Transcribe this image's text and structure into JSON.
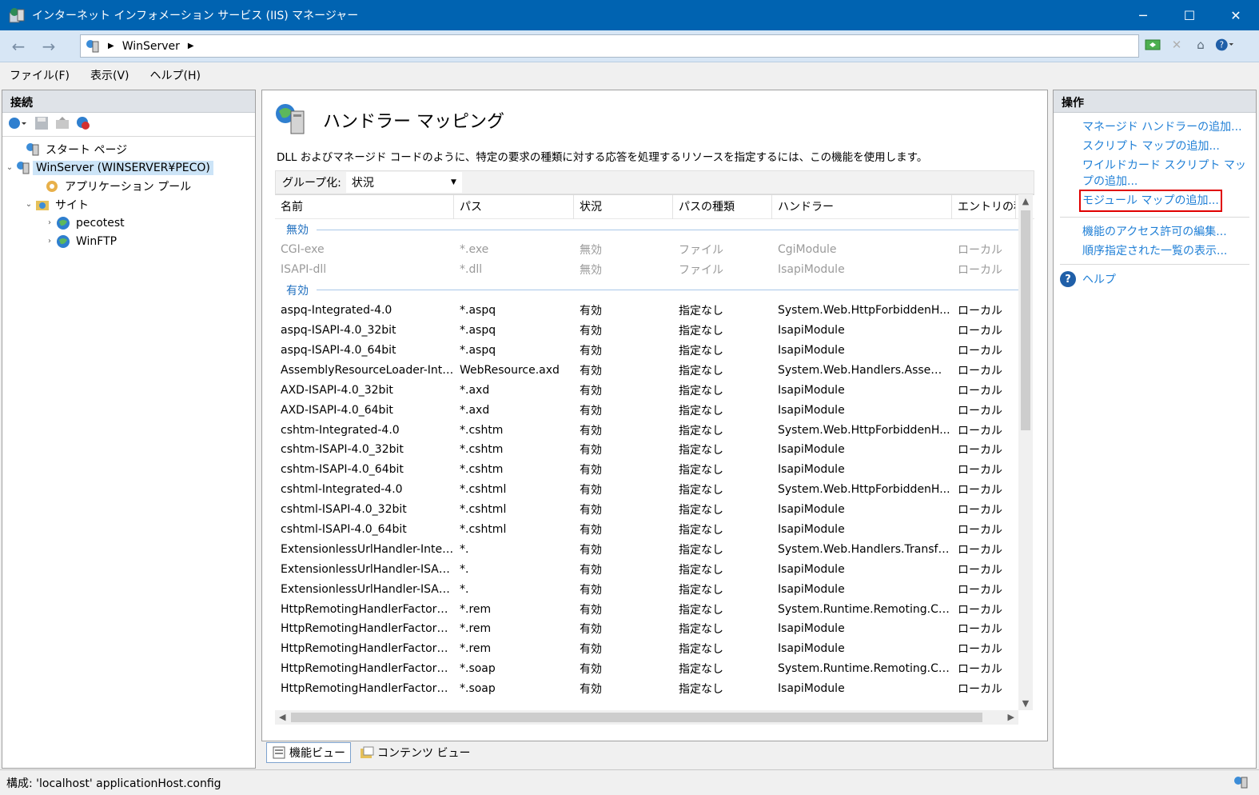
{
  "window": {
    "title": "インターネット インフォメーション サービス (IIS) マネージャー",
    "minimize": "─",
    "maximize": "☐",
    "close": "✕"
  },
  "address": {
    "crumb": "WinServer"
  },
  "menu": [
    "ファイル(F)",
    "表示(V)",
    "ヘルプ(H)"
  ],
  "connections": {
    "header": "接続",
    "tree": [
      {
        "label": "スタート ページ",
        "icon": "start-page-icon"
      },
      {
        "label": "WinServer (WINSERVER¥PECO)",
        "icon": "server-icon",
        "selected": true
      },
      {
        "label": "アプリケーション プール",
        "icon": "app-pool-icon"
      },
      {
        "label": "サイト",
        "icon": "sites-folder-icon"
      },
      {
        "label": "pecotest",
        "icon": "globe-icon"
      },
      {
        "label": "WinFTP",
        "icon": "globe-icon"
      }
    ]
  },
  "feature": {
    "title": "ハンドラー マッピング",
    "description": "DLL およびマネージド コードのように、特定の要求の種類に対する応答を処理するリソースを指定するには、この機能を使用します。",
    "group_label": "グループ化:",
    "group_value": "状況",
    "columns": [
      "名前",
      "パス",
      "状況",
      "パスの種類",
      "ハンドラー",
      "エントリの種類"
    ],
    "group_disabled": "無効",
    "group_enabled": "有効",
    "disabled_rows": [
      [
        "CGI-exe",
        "*.exe",
        "無効",
        "ファイル",
        "CgiModule",
        "ローカル"
      ],
      [
        "ISAPI-dll",
        "*.dll",
        "無効",
        "ファイル",
        "IsapiModule",
        "ローカル"
      ]
    ],
    "enabled_rows": [
      [
        "aspq-Integrated-4.0",
        "*.aspq",
        "有効",
        "指定なし",
        "System.Web.HttpForbiddenH...",
        "ローカル"
      ],
      [
        "aspq-ISAPI-4.0_32bit",
        "*.aspq",
        "有効",
        "指定なし",
        "IsapiModule",
        "ローカル"
      ],
      [
        "aspq-ISAPI-4.0_64bit",
        "*.aspq",
        "有効",
        "指定なし",
        "IsapiModule",
        "ローカル"
      ],
      [
        "AssemblyResourceLoader-Inte...",
        "WebResource.axd",
        "有効",
        "指定なし",
        "System.Web.Handlers.Assem...",
        "ローカル"
      ],
      [
        "AXD-ISAPI-4.0_32bit",
        "*.axd",
        "有効",
        "指定なし",
        "IsapiModule",
        "ローカル"
      ],
      [
        "AXD-ISAPI-4.0_64bit",
        "*.axd",
        "有効",
        "指定なし",
        "IsapiModule",
        "ローカル"
      ],
      [
        "cshtm-Integrated-4.0",
        "*.cshtm",
        "有効",
        "指定なし",
        "System.Web.HttpForbiddenH...",
        "ローカル"
      ],
      [
        "cshtm-ISAPI-4.0_32bit",
        "*.cshtm",
        "有効",
        "指定なし",
        "IsapiModule",
        "ローカル"
      ],
      [
        "cshtm-ISAPI-4.0_64bit",
        "*.cshtm",
        "有効",
        "指定なし",
        "IsapiModule",
        "ローカル"
      ],
      [
        "cshtml-Integrated-4.0",
        "*.cshtml",
        "有効",
        "指定なし",
        "System.Web.HttpForbiddenH...",
        "ローカル"
      ],
      [
        "cshtml-ISAPI-4.0_32bit",
        "*.cshtml",
        "有効",
        "指定なし",
        "IsapiModule",
        "ローカル"
      ],
      [
        "cshtml-ISAPI-4.0_64bit",
        "*.cshtml",
        "有効",
        "指定なし",
        "IsapiModule",
        "ローカル"
      ],
      [
        "ExtensionlessUrlHandler-Integ...",
        "*.",
        "有効",
        "指定なし",
        "System.Web.Handlers.Transfe...",
        "ローカル"
      ],
      [
        "ExtensionlessUrlHandler-ISAPI...",
        "*.",
        "有効",
        "指定なし",
        "IsapiModule",
        "ローカル"
      ],
      [
        "ExtensionlessUrlHandler-ISAPI...",
        "*.",
        "有効",
        "指定なし",
        "IsapiModule",
        "ローカル"
      ],
      [
        "HttpRemotingHandlerFactory-...",
        "*.rem",
        "有効",
        "指定なし",
        "System.Runtime.Remoting.Ch...",
        "ローカル"
      ],
      [
        "HttpRemotingHandlerFactory-...",
        "*.rem",
        "有効",
        "指定なし",
        "IsapiModule",
        "ローカル"
      ],
      [
        "HttpRemotingHandlerFactory-...",
        "*.rem",
        "有効",
        "指定なし",
        "IsapiModule",
        "ローカル"
      ],
      [
        "HttpRemotingHandlerFactory-...",
        "*.soap",
        "有効",
        "指定なし",
        "System.Runtime.Remoting.Ch...",
        "ローカル"
      ],
      [
        "HttpRemotingHandlerFactory-...",
        "*.soap",
        "有効",
        "指定なし",
        "IsapiModule",
        "ローカル"
      ]
    ]
  },
  "view_tabs": [
    "機能ビュー",
    "コンテンツ ビュー"
  ],
  "actions": {
    "header": "操作",
    "items": [
      "マネージド ハンドラーの追加...",
      "スクリプト マップの追加...",
      "ワイルドカード スクリプト マップの追加...",
      "モジュール マップの追加..."
    ],
    "items2": [
      "機能のアクセス許可の編集...",
      "順序指定された一覧の表示..."
    ],
    "help": "ヘルプ"
  },
  "status": "構成: 'localhost' applicationHost.config",
  "colors": {
    "title_bar": "#0063b1",
    "link": "#1f7fd6",
    "highlight_box": "#e00000"
  }
}
